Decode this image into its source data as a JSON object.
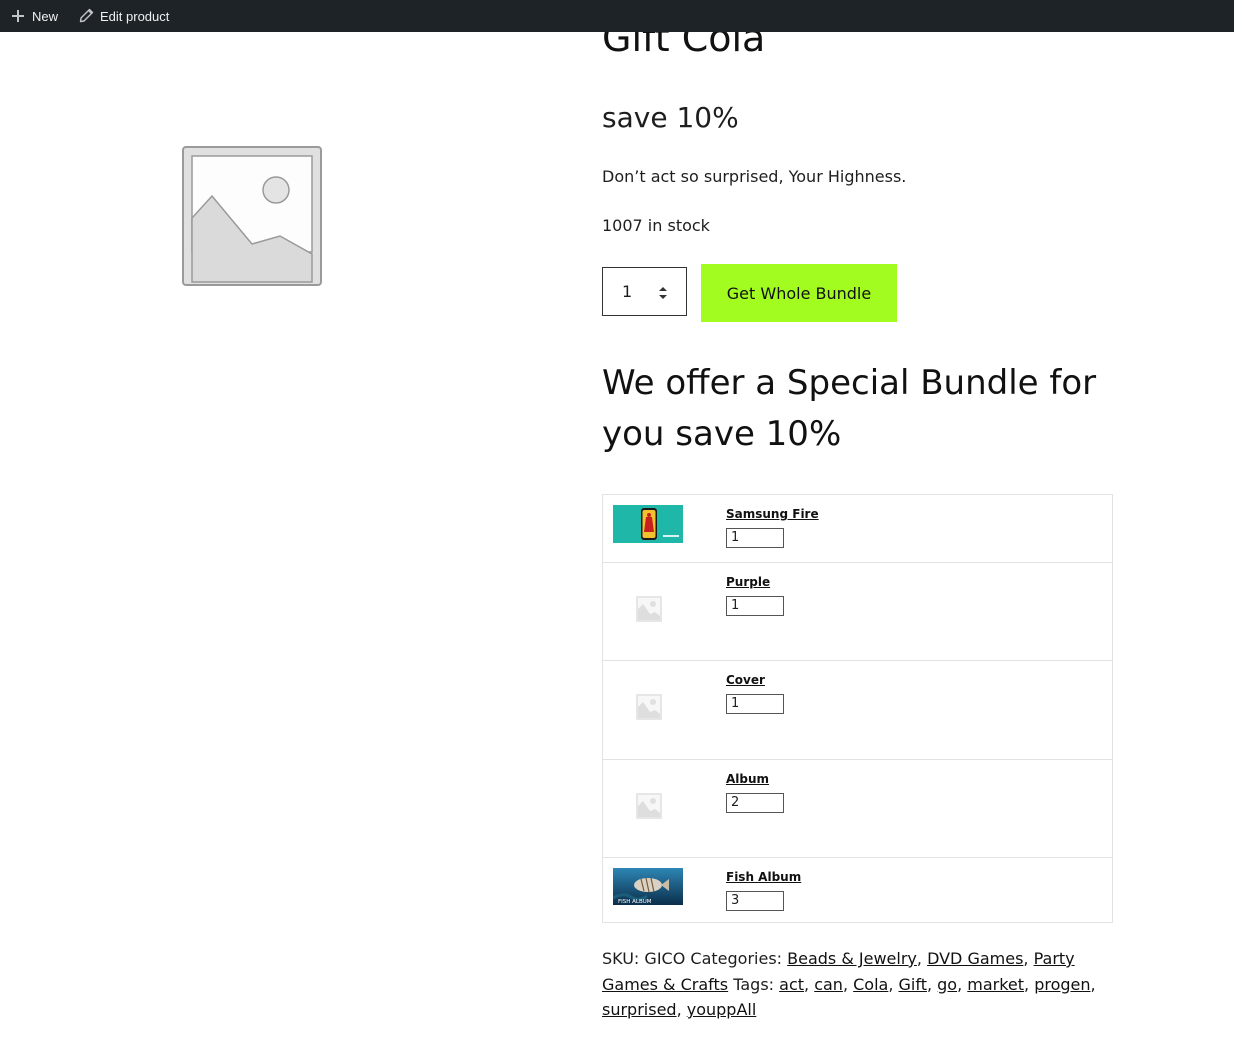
{
  "adminbar": {
    "new_label": "New",
    "edit_label": "Edit product",
    "new_icon": "plus-icon",
    "edit_icon": "pencil-icon",
    "background": "#1d2327"
  },
  "product": {
    "title": "Gift Cola",
    "price_text": "save 10%",
    "short_description": "Don’t act so surprised, Your Highness.",
    "stock": "1007 in stock",
    "quantity": "1",
    "add_button_label": "Get Whole Bundle",
    "add_button_color": "#a3fc1f"
  },
  "bundle": {
    "heading": "We offer a Special Bundle for you save 10%",
    "items": [
      {
        "name": "Samsung Fire",
        "qty": "1",
        "thumb": "phone-thumbnail"
      },
      {
        "name": "Purple",
        "qty": "1",
        "thumb": "placeholder-icon"
      },
      {
        "name": "Cover",
        "qty": "1",
        "thumb": "placeholder-icon"
      },
      {
        "name": "Album",
        "qty": "2",
        "thumb": "placeholder-icon"
      },
      {
        "name": "Fish Album",
        "qty": "3",
        "thumb": "fish-album-thumbnail",
        "thumb_text": "FISH ALBUM"
      }
    ]
  },
  "meta": {
    "sku_label": "SKU:",
    "sku": "GICO",
    "categories_label": "Categories:",
    "categories": [
      "Beads & Jewelry",
      "DVD Games",
      "Party Games & Crafts"
    ],
    "tags_label": "Tags:",
    "tags": [
      "act",
      "can",
      "Cola",
      "Gift",
      "go",
      "market",
      "progen",
      "surprised",
      "youppAll"
    ]
  }
}
